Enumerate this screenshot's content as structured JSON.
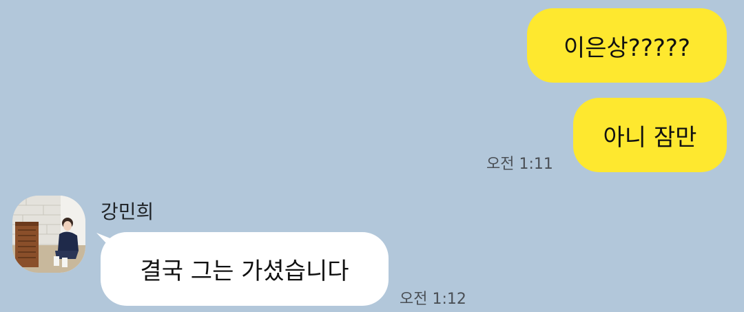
{
  "chat": {
    "messages": [
      {
        "from": "me",
        "text": "이은상?????"
      },
      {
        "from": "me",
        "text": "아니 잠만",
        "time": "오전 1:11"
      },
      {
        "from": "other",
        "sender": "강민희",
        "text": "결국 그는 가셨습니다",
        "time": "오전 1:12"
      }
    ]
  },
  "colors": {
    "background": "#b2c7da",
    "my_bubble": "#fee82f",
    "other_bubble": "#ffffff"
  },
  "icons": {
    "sender_avatar": "profile-photo"
  }
}
